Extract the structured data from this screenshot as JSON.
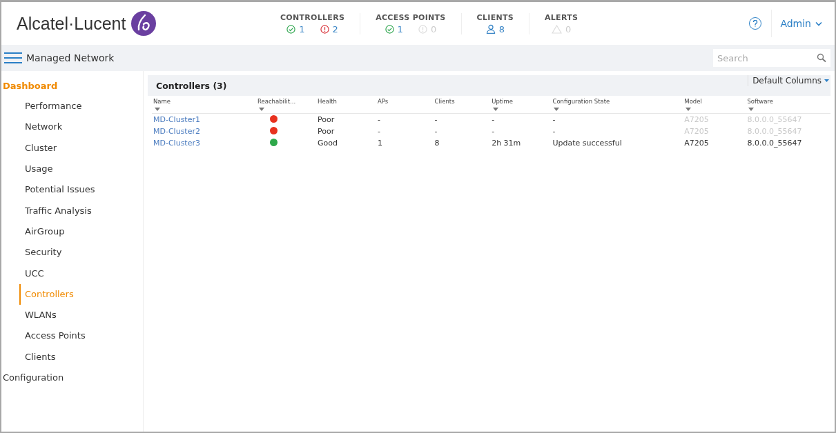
{
  "brand": {
    "name": "Alcatel·Lucent"
  },
  "summary": [
    {
      "title": "CONTROLLERS",
      "stats": [
        {
          "kind": "ok",
          "value": "1",
          "muted": false
        },
        {
          "kind": "error",
          "value": "2",
          "muted": false
        }
      ]
    },
    {
      "title": "ACCESS POINTS",
      "stats": [
        {
          "kind": "ok",
          "value": "1",
          "muted": false
        },
        {
          "kind": "error",
          "value": "0",
          "muted": true
        }
      ]
    },
    {
      "title": "CLIENTS",
      "stats": [
        {
          "kind": "user",
          "value": "8",
          "muted": false
        }
      ]
    },
    {
      "title": "ALERTS",
      "stats": [
        {
          "kind": "warning",
          "value": "0",
          "muted": true
        }
      ]
    }
  ],
  "user": {
    "name": "Admin"
  },
  "breadcrumb": {
    "label": "Managed Network"
  },
  "search": {
    "placeholder": "Search"
  },
  "sidebar": {
    "sections": [
      {
        "label": "Dashboard",
        "selected": true,
        "children": [
          {
            "label": "Performance",
            "selected": false
          },
          {
            "label": "Network",
            "selected": false
          },
          {
            "label": "Cluster",
            "selected": false
          },
          {
            "label": "Usage",
            "selected": false
          },
          {
            "label": "Potential Issues",
            "selected": false
          },
          {
            "label": "Traffic Analysis",
            "selected": false
          },
          {
            "label": "AirGroup",
            "selected": false
          },
          {
            "label": "Security",
            "selected": false
          },
          {
            "label": "UCC",
            "selected": false
          },
          {
            "label": "Controllers",
            "selected": true
          },
          {
            "label": "WLANs",
            "selected": false
          },
          {
            "label": "Access Points",
            "selected": false
          },
          {
            "label": "Clients",
            "selected": false
          }
        ]
      },
      {
        "label": "Configuration",
        "selected": false
      }
    ]
  },
  "columns_menu": {
    "label": "Default Columns"
  },
  "table": {
    "title": "Controllers (3)",
    "columns": [
      {
        "label": "Name",
        "filter": true
      },
      {
        "label": "Reachabilit...",
        "filter": true
      },
      {
        "label": "Health",
        "filter": false
      },
      {
        "label": "APs",
        "filter": false
      },
      {
        "label": "Clients",
        "filter": false
      },
      {
        "label": "Uptime",
        "filter": true
      },
      {
        "label": "Configuration State",
        "filter": true
      },
      {
        "label": "Model",
        "filter": true
      },
      {
        "label": "Software",
        "filter": true
      }
    ],
    "rows": [
      {
        "name": "MD-Cluster1",
        "color": "#e8311f",
        "health": "Poor",
        "aps": "-",
        "clients": "-",
        "uptime": "-",
        "config_state": "-",
        "model": "A7205",
        "software": "8.0.0.0_55647",
        "dimmed": true
      },
      {
        "name": "MD-Cluster2",
        "color": "#e8311f",
        "health": "Poor",
        "aps": "-",
        "clients": "-",
        "uptime": "-",
        "config_state": "-",
        "model": "A7205",
        "software": "8.0.0.0_55647",
        "dimmed": true
      },
      {
        "name": "MD-Cluster3",
        "color": "#2ea84a",
        "health": "Good",
        "aps": "1",
        "clients": "8",
        "uptime": "2h 31m",
        "config_state": "Update successful",
        "model": "A7205",
        "software": "8.0.0.0_55647",
        "dimmed": false
      }
    ]
  }
}
